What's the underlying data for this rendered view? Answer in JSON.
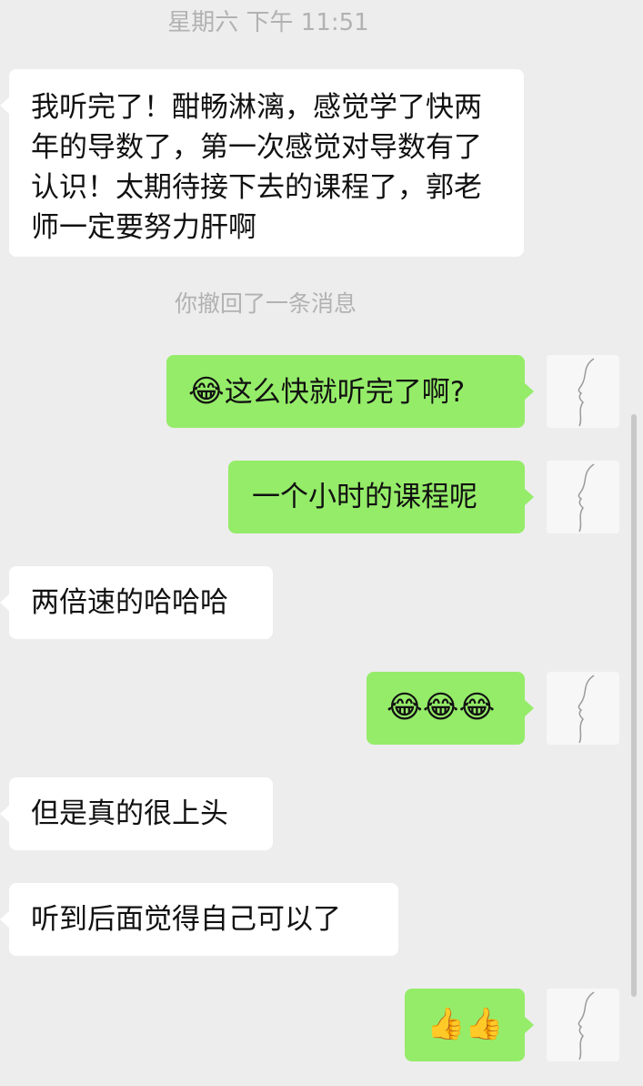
{
  "chat": {
    "timestamp": "星期六 下午 11:51",
    "recall_notice": "你撤回了一条消息",
    "messages": [
      {
        "side": "in",
        "text": "我听完了！酣畅淋漓，感觉学了快两年的导数了，第一次感觉对导数有了认识！太期待接下去的课程了，郭老师一定要努力肝啊"
      },
      {
        "side": "out",
        "emoji": "😂",
        "text": "这么快就听完了啊?"
      },
      {
        "side": "out",
        "text": "一个小时的课程呢"
      },
      {
        "side": "in",
        "text": "两倍速的哈哈哈"
      },
      {
        "side": "out",
        "emoji": "😂😂😂"
      },
      {
        "side": "in",
        "text": "但是真的很上头"
      },
      {
        "side": "in",
        "text": "听到后面觉得自己可以了"
      },
      {
        "side": "out",
        "emoji": "👍👍"
      }
    ]
  }
}
